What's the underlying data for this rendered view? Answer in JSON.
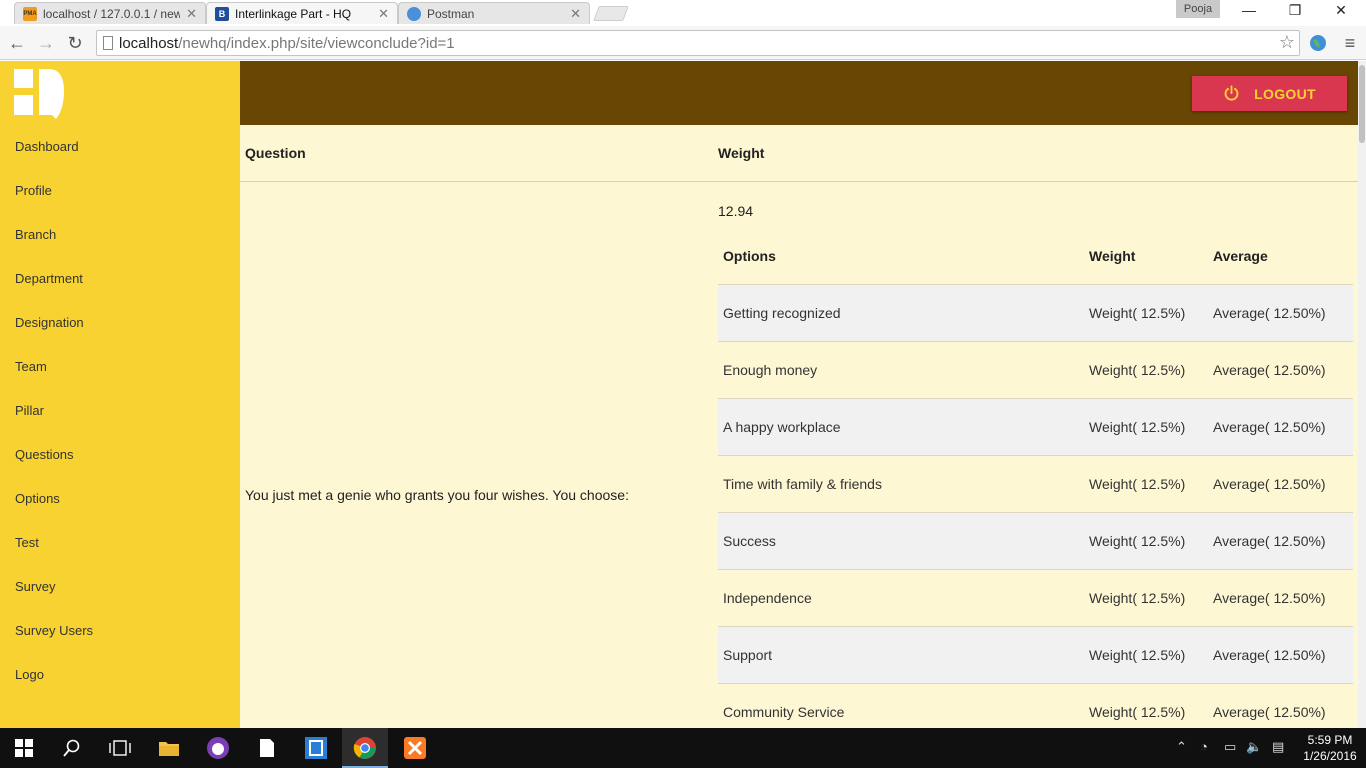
{
  "browser": {
    "tabs": [
      {
        "title": "localhost / 127.0.0.1 / new",
        "favicon_text": "PMA"
      },
      {
        "title": "Interlinkage Part - HQ",
        "favicon_text": "B"
      },
      {
        "title": "Postman"
      }
    ],
    "profile": "Pooja",
    "url_host": "localhost",
    "url_path": "/newhq/index.php/site/viewconclude?id=1",
    "window_controls": {
      "minimize": "—",
      "restore": "❐",
      "close": "✕"
    }
  },
  "sidebar": {
    "items": [
      {
        "label": "Dashboard"
      },
      {
        "label": "Profile"
      },
      {
        "label": "Branch"
      },
      {
        "label": "Department"
      },
      {
        "label": "Designation"
      },
      {
        "label": "Team"
      },
      {
        "label": "Pillar"
      },
      {
        "label": "Questions"
      },
      {
        "label": "Options"
      },
      {
        "label": "Test"
      },
      {
        "label": "Survey"
      },
      {
        "label": "Survey Users"
      },
      {
        "label": "Logo"
      }
    ]
  },
  "header": {
    "logout_label": "LOGOUT"
  },
  "table": {
    "headers": {
      "question": "Question",
      "weight": "Weight"
    },
    "question_text": "You just met a genie who grants you four wishes. You choose:",
    "weight_value": "12.94",
    "options_headers": {
      "options": "Options",
      "weight": "Weight",
      "average": "Average"
    },
    "options": [
      {
        "option": "Getting recognized",
        "weight": "Weight( 12.5%)",
        "average": "Average( 12.50%)"
      },
      {
        "option": "Enough money",
        "weight": "Weight( 12.5%)",
        "average": "Average( 12.50%)"
      },
      {
        "option": "A happy workplace",
        "weight": "Weight( 12.5%)",
        "average": "Average( 12.50%)"
      },
      {
        "option": "Time with family & friends",
        "weight": "Weight( 12.5%)",
        "average": "Average( 12.50%)"
      },
      {
        "option": "Success",
        "weight": "Weight( 12.5%)",
        "average": "Average( 12.50%)"
      },
      {
        "option": "Independence",
        "weight": "Weight( 12.5%)",
        "average": "Average( 12.50%)"
      },
      {
        "option": "Support",
        "weight": "Weight( 12.5%)",
        "average": "Average( 12.50%)"
      },
      {
        "option": "Community Service",
        "weight": "Weight( 12.5%)",
        "average": "Average( 12.50%)"
      }
    ]
  },
  "taskbar": {
    "time": "5:59 PM",
    "date": "1/26/2016"
  },
  "colors": {
    "sidebar": "#f8d231",
    "header": "#684603",
    "content_bg": "#fef7d4",
    "logout_bg": "#d9364f",
    "logout_text": "#f8d231"
  }
}
